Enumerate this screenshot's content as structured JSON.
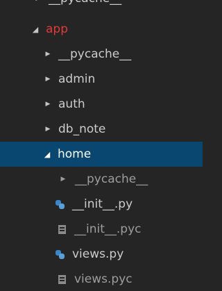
{
  "explorer": {
    "items": [
      {
        "label": "__pycache__",
        "expanded": false,
        "type": "folder",
        "cut_off": true
      },
      {
        "label": "app",
        "expanded": true,
        "type": "folder",
        "label_color": "#e13a3a"
      },
      {
        "label": "__pycache__",
        "expanded": false,
        "type": "folder"
      },
      {
        "label": "admin",
        "expanded": false,
        "type": "folder"
      },
      {
        "label": "auth",
        "expanded": false,
        "type": "folder"
      },
      {
        "label": "db_note",
        "expanded": false,
        "type": "folder"
      },
      {
        "label": "home",
        "expanded": true,
        "type": "folder",
        "selected": true,
        "selection_color": "#094771"
      },
      {
        "label": "__pycache__",
        "expanded": false,
        "type": "folder",
        "dimmed": true
      },
      {
        "label": "__init__.py",
        "type": "file",
        "icon": "python-file-icon"
      },
      {
        "label": "__init__.pyc",
        "type": "file",
        "icon": "compiled-file-icon",
        "dimmed": true
      },
      {
        "label": "views.py",
        "type": "file",
        "icon": "python-file-icon"
      },
      {
        "label": "views.pyc",
        "type": "file",
        "icon": "compiled-file-icon",
        "dimmed": true
      }
    ]
  }
}
